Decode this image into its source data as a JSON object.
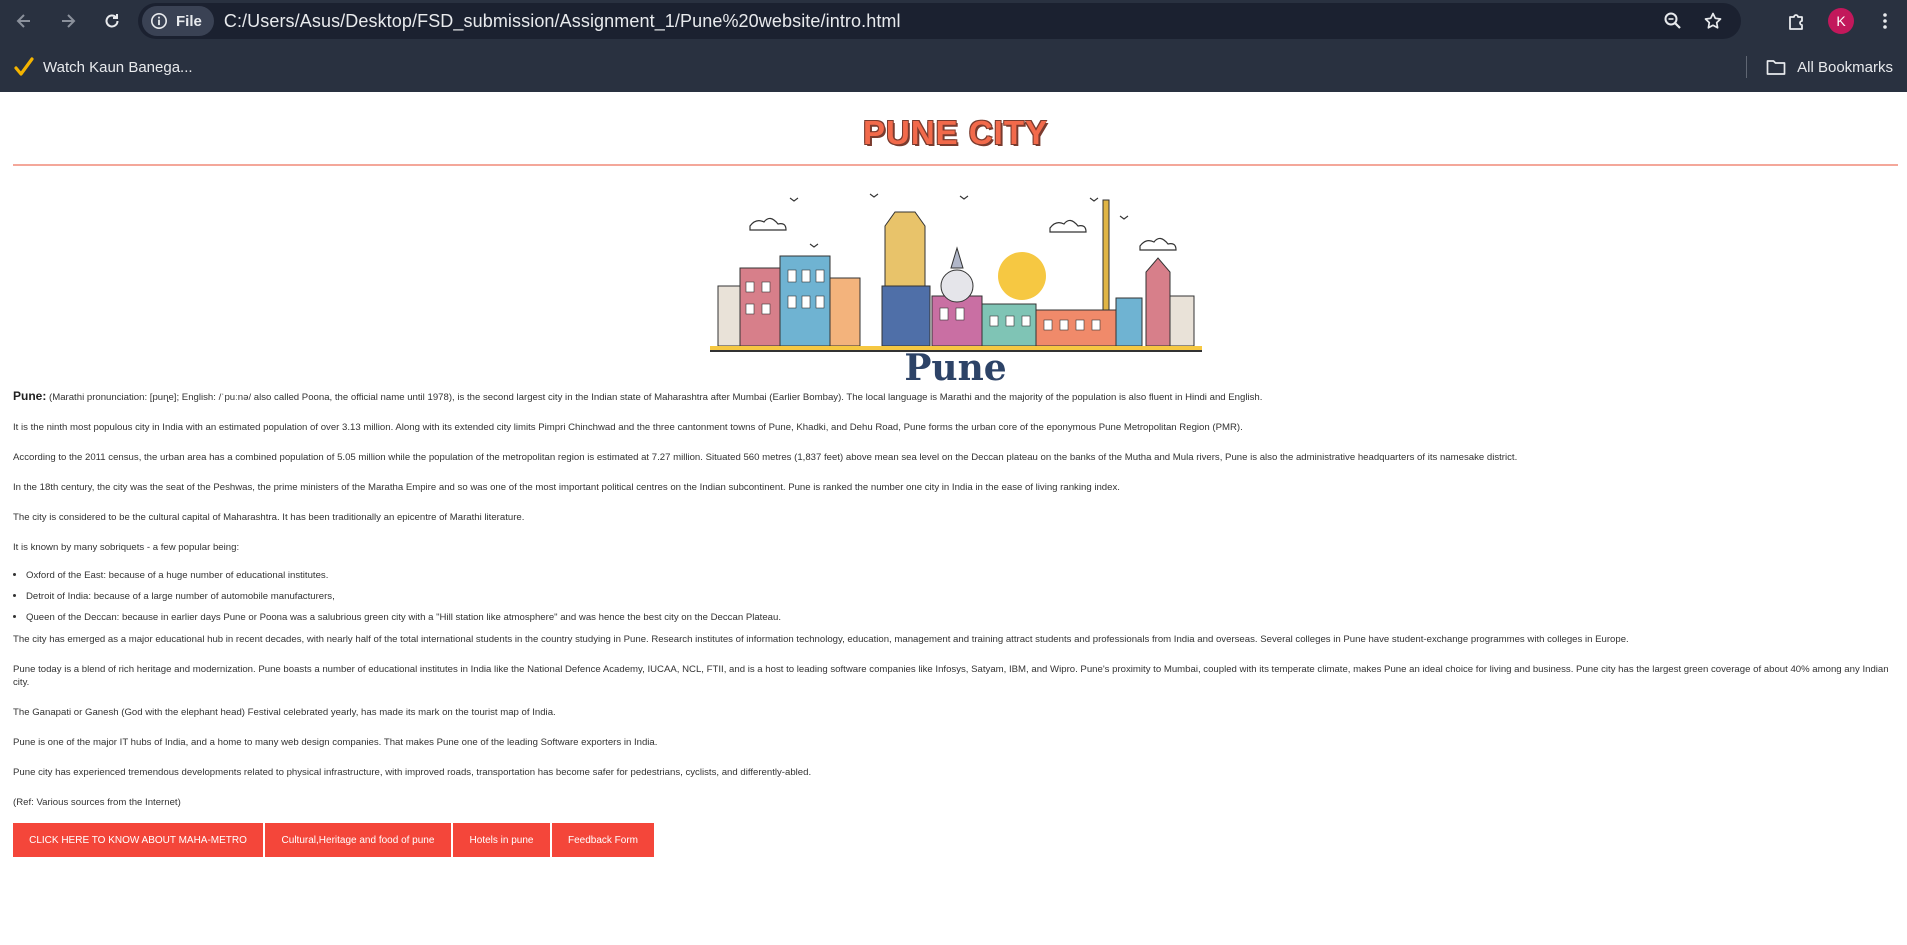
{
  "browser": {
    "site_chip_label": "File",
    "url": "C:/Users/Asus/Desktop/FSD_submission/Assignment_1/Pune%20website/intro.html",
    "profile_initial": "K",
    "bookmarks": [
      {
        "label": "Watch Kaun Banega...",
        "icon": "check-icon"
      }
    ],
    "all_bookmarks_label": "All Bookmarks",
    "colors": {
      "chrome_bg": "#293140",
      "omnibox_bg": "#1b2130",
      "avatar": "#c2185b"
    }
  },
  "page": {
    "title": "PUNE CITY",
    "hero_caption": "Pune",
    "intro_lead": "Pune:",
    "intro_text": " (Marathi pronunciation: [puɳe]; English: /ˈpuːnə/ also called Poona, the official name until 1978), is the second largest city in the Indian state of Maharashtra after Mumbai (Earlier Bombay). The local language is Marathi and the majority of the population is also fluent in Hindi and English.",
    "paragraphs_a": [
      "It is the ninth most populous city in India with an estimated population of over 3.13 million. Along with its extended city limits Pimpri Chinchwad and the three cantonment towns of Pune, Khadki, and Dehu Road, Pune forms the urban core of the eponymous Pune Metropolitan Region (PMR).",
      "According to the 2011 census, the urban area has a combined population of 5.05 million while the population of the metropolitan region is estimated at 7.27 million. Situated 560 metres (1,837 feet) above mean sea level on the Deccan plateau on the banks of the Mutha and Mula rivers, Pune is also the administrative headquarters of its namesake district.",
      "In the 18th century, the city was the seat of the Peshwas, the prime ministers of the Maratha Empire and so was one of the most important political centres on the Indian subcontinent. Pune is ranked the number one city in India in the ease of living ranking index.",
      "The city is considered to be the cultural capital of Maharashtra. It has been traditionally an epicentre of Marathi literature.",
      "It is known by many sobriquets - a few popular being:"
    ],
    "sobriquets": [
      "Oxford of the East: because of a huge number of educational institutes.",
      "Detroit of India: because of a large number of automobile manufacturers,",
      "Queen of the Deccan: because in earlier days Pune or Poona was a salubrious green city with a \"Hill station like atmosphere\" and was hence the best city on the Deccan Plateau."
    ],
    "paragraphs_b": [
      "The city has emerged as a major educational hub in recent decades, with nearly half of the total international students in the country studying in Pune. Research institutes of information technology, education, management and training attract students and professionals from India and overseas. Several colleges in Pune have student-exchange programmes with colleges in Europe.",
      "Pune today is a blend of rich heritage and modernization. Pune boasts a number of educational institutes in India like the National Defence Academy, IUCAA, NCL, FTII, and is a host to leading software companies like Infosys, Satyam, IBM, and Wipro. Pune's proximity to Mumbai, coupled with its temperate climate, makes Pune an ideal choice for living and business. Pune city has the largest green coverage of about 40% among any Indian city.",
      "The Ganapati or Ganesh (God with the elephant head) Festival celebrated yearly, has made its mark on the tourist map of India.",
      "Pune is one of the major IT hubs of India, and a home to many web design companies. That makes Pune one of the leading Software exporters in India.",
      "Pune city has experienced tremendous developments related to physical infrastructure, with improved roads, transportation has become safer for pedestrians, cyclists, and differently-abled.",
      "(Ref: Various sources from the Internet)"
    ],
    "buttons": [
      "CLICK HERE TO KNOW ABOUT MAHA-METRO",
      "Cultural,Heritage and food of pune",
      "Hotels in pune",
      "Feedback Form"
    ],
    "colors": {
      "title": "#f26a4b",
      "rule": "#f4a79a",
      "caption": "#2d4367",
      "button": "#f4463a"
    }
  }
}
